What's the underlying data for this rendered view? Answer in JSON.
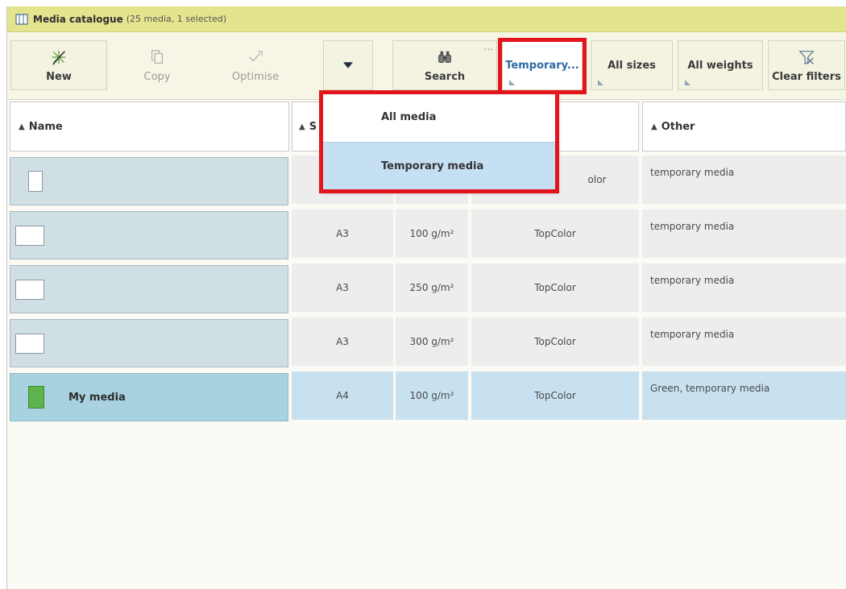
{
  "window": {
    "title": "Media catalogue",
    "count": "(25 media, 1 selected)",
    "icon": "catalogue-icon"
  },
  "toolbar": {
    "new_label": "New",
    "copy_label": "Copy",
    "optimise_label": "Optimise",
    "search_label": "Search",
    "more_indicator": "...",
    "filter_type_label": "Temporary...",
    "filter_size_label": "All sizes",
    "filter_weight_label": "All weights",
    "clear_filters_label": "Clear filters"
  },
  "dropdown": {
    "items": [
      {
        "label": "All media",
        "active": false
      },
      {
        "label": "Temporary media",
        "active": true
      }
    ]
  },
  "table": {
    "columns": {
      "name": "Name",
      "size": "S",
      "other": "Other"
    },
    "rows": [
      {
        "name": "",
        "size": "",
        "weight": "",
        "type": "TopColor",
        "type_visible": "olor",
        "other": "temporary media",
        "swatch": "portrait",
        "selected": false
      },
      {
        "name": "",
        "size": "A3",
        "weight": "100 g/m²",
        "type": "TopColor",
        "other": "temporary media",
        "swatch": "landscape",
        "selected": false
      },
      {
        "name": "",
        "size": "A3",
        "weight": "250 g/m²",
        "type": "TopColor",
        "other": "temporary media",
        "swatch": "landscape",
        "selected": false
      },
      {
        "name": "",
        "size": "A3",
        "weight": "300 g/m²",
        "type": "TopColor",
        "other": "temporary media",
        "swatch": "landscape",
        "selected": false
      },
      {
        "name": "My media",
        "size": "A4",
        "weight": "100 g/m²",
        "type": "TopColor",
        "other": "Green, temporary media",
        "swatch": "green",
        "selected": true
      }
    ]
  },
  "colors": {
    "title_bar": "#e4e48f",
    "highlight_box": "#e3141c",
    "selected_row": "#c8e1f1",
    "swatch_green": "#5fb34f"
  }
}
